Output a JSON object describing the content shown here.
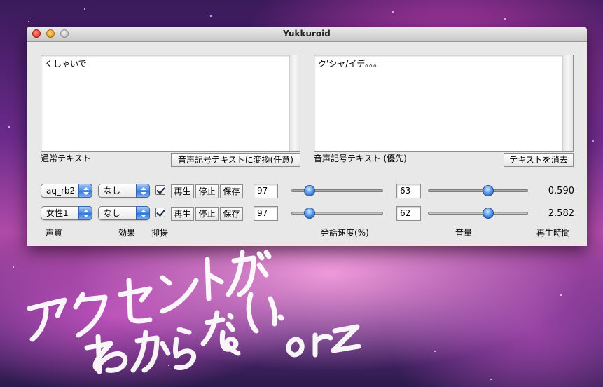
{
  "window": {
    "title": "Yukkuroid"
  },
  "normal_text": {
    "value": "くしゃいで",
    "label": "通常テキスト"
  },
  "phonetic_text": {
    "value": "ク'シャ/イデ。。。",
    "label": "音声記号テキスト (優先)"
  },
  "buttons": {
    "convert": "音声記号テキストに変換(任意)",
    "clear": "テキストを消去"
  },
  "rows": [
    {
      "voice": "aq_rb2",
      "effect": "なし",
      "suppress": true,
      "play": "再生",
      "stop": "停止",
      "save": "保存",
      "speed": "97",
      "speed_level": 0.2,
      "volume": "63",
      "volume_level": 0.6,
      "time": "0.590"
    },
    {
      "voice": "女性1",
      "effect": "なし",
      "suppress": true,
      "play": "再生",
      "stop": "停止",
      "save": "保存",
      "speed": "97",
      "speed_level": 0.2,
      "volume": "62",
      "volume_level": 0.6,
      "time": "2.582"
    }
  ],
  "column_labels": {
    "voice": "声質",
    "effect": "効果",
    "suppress": "抑揚",
    "speed": "発話速度(%)",
    "volume": "音量",
    "time": "再生時間"
  },
  "overlay_text": "アクセントが わからない・・・ orz",
  "colors": {
    "accent": "#3473d6",
    "window_bg": "#e8e8e8"
  }
}
